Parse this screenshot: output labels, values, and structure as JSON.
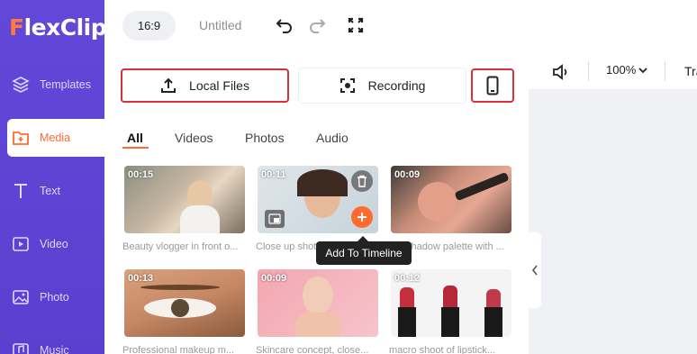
{
  "app": {
    "logo_prefix": "F",
    "logo_rest": "lexClip"
  },
  "sidebar": {
    "items": [
      {
        "label": "Templates",
        "icon": "layers-icon"
      },
      {
        "label": "Media",
        "icon": "media-folder-icon",
        "active": true
      },
      {
        "label": "Text",
        "icon": "text-icon"
      },
      {
        "label": "Video",
        "icon": "video-play-icon"
      },
      {
        "label": "Photo",
        "icon": "photo-icon"
      },
      {
        "label": "Music",
        "icon": "music-icon"
      }
    ]
  },
  "header": {
    "ratio": "16:9",
    "title": "Untitled"
  },
  "media": {
    "local_files": "Local Files",
    "recording": "Recording",
    "tabs": [
      "All",
      "Videos",
      "Photos",
      "Audio"
    ],
    "tooltip": "Add To Timeline",
    "items": [
      {
        "duration": "00:15",
        "caption": "Beauty vlogger in front o..."
      },
      {
        "duration": "00:11",
        "caption": "Close up shot"
      },
      {
        "duration": "00:09",
        "caption": "Eyeshadow palette with ..."
      },
      {
        "duration": "00:13",
        "caption": "Professional makeup m..."
      },
      {
        "duration": "00:09",
        "caption": "Skincare concept, close..."
      },
      {
        "duration": "00:12",
        "caption": "macro shoot of lipstick..."
      }
    ]
  },
  "preview_toolbar": {
    "zoom": "100%",
    "truncated_label": "Tra"
  },
  "colors": {
    "sidebar": "#5b3fd0",
    "accent": "#ff6a2f",
    "highlight": "#d9313b"
  }
}
